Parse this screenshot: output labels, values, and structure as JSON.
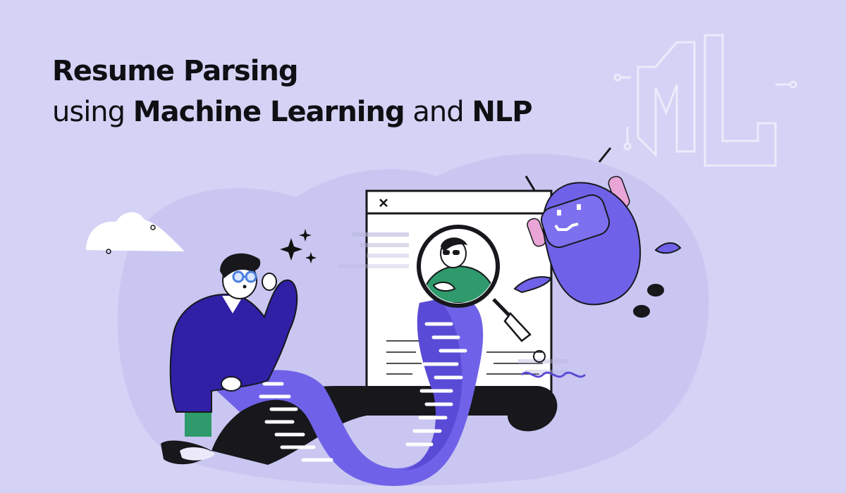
{
  "title": {
    "line1": "Resume Parsing",
    "line2_part1": "using ",
    "line2_bold1": "Machine Learning",
    "line2_part2": " and ",
    "line2_bold2": "NLP"
  },
  "logo": {
    "text": "ML"
  },
  "window": {
    "close_symbol": "✕"
  },
  "colors": {
    "background": "#d4d3f5",
    "blob": "#c8c6f0",
    "indigo": "#2f20a6",
    "purple": "#6f62e8",
    "green": "#2f9a6b",
    "dark": "#17171c",
    "pink": "#e8a5d6",
    "white": "#ffffff"
  },
  "icons": [
    "close-icon",
    "sparkle-icon",
    "magnifier-icon",
    "robot-icon",
    "cloud-icon",
    "ml-logo-icon",
    "squiggle-icon"
  ]
}
